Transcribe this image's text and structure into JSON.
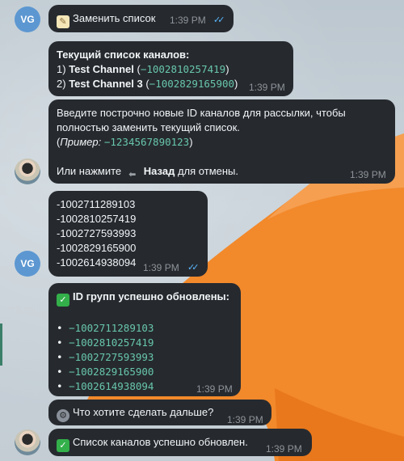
{
  "colors": {
    "bubble": "#262a2f",
    "time": "#8e9399",
    "code": "#68c6ab",
    "check": "#5bb8ff",
    "accent": "#3b7f69"
  },
  "messages": {
    "m1": {
      "avatar": "VG",
      "text": "Заменить список",
      "time": "1:39 PM",
      "icon": "memo-icon",
      "read": true
    },
    "m2": {
      "title": "Текущий список каналов:",
      "rows": [
        {
          "num": "1)",
          "name": "Test Channel",
          "open": "(",
          "id": "−1002810257419",
          "close": ")"
        },
        {
          "num": "2)",
          "name": "Test Channel 3",
          "open": "(",
          "id": "−1002829165900",
          "close": ")"
        }
      ],
      "time": "1:39 PM"
    },
    "m3": {
      "line1": "Введите построчно новые ID каналов для рассылки, чтобы",
      "line2": "полностью заменить текущий список.",
      "example_open": "(",
      "example_label": "Пример:",
      "example_value": "−1234567890123",
      "example_close": ")",
      "line4_pre": "Или нажмите",
      "line4_button": "Назад",
      "line4_post": "для отмены.",
      "time": "1:39 PM"
    },
    "m4": {
      "avatar": "VG",
      "ids": [
        "-1002711289103",
        "-1002810257419",
        "-1002727593993",
        "-1002829165900",
        "-1002614938094"
      ],
      "time": "1:39 PM",
      "read": true
    },
    "m5": {
      "title": "ID групп успешно обновлены:",
      "bullet": "•",
      "ids": [
        "−1002711289103",
        "−1002810257419",
        "−1002727593993",
        "−1002829165900",
        "−1002614938094"
      ],
      "time": "1:39 PM"
    },
    "m6": {
      "text": "Что хотите сделать дальше?",
      "time": "1:39 PM",
      "icon": "gear-icon"
    },
    "m7": {
      "text": "Список каналов успешно обновлен.",
      "time": "1:39 PM",
      "icon": "check-mark-icon"
    }
  }
}
